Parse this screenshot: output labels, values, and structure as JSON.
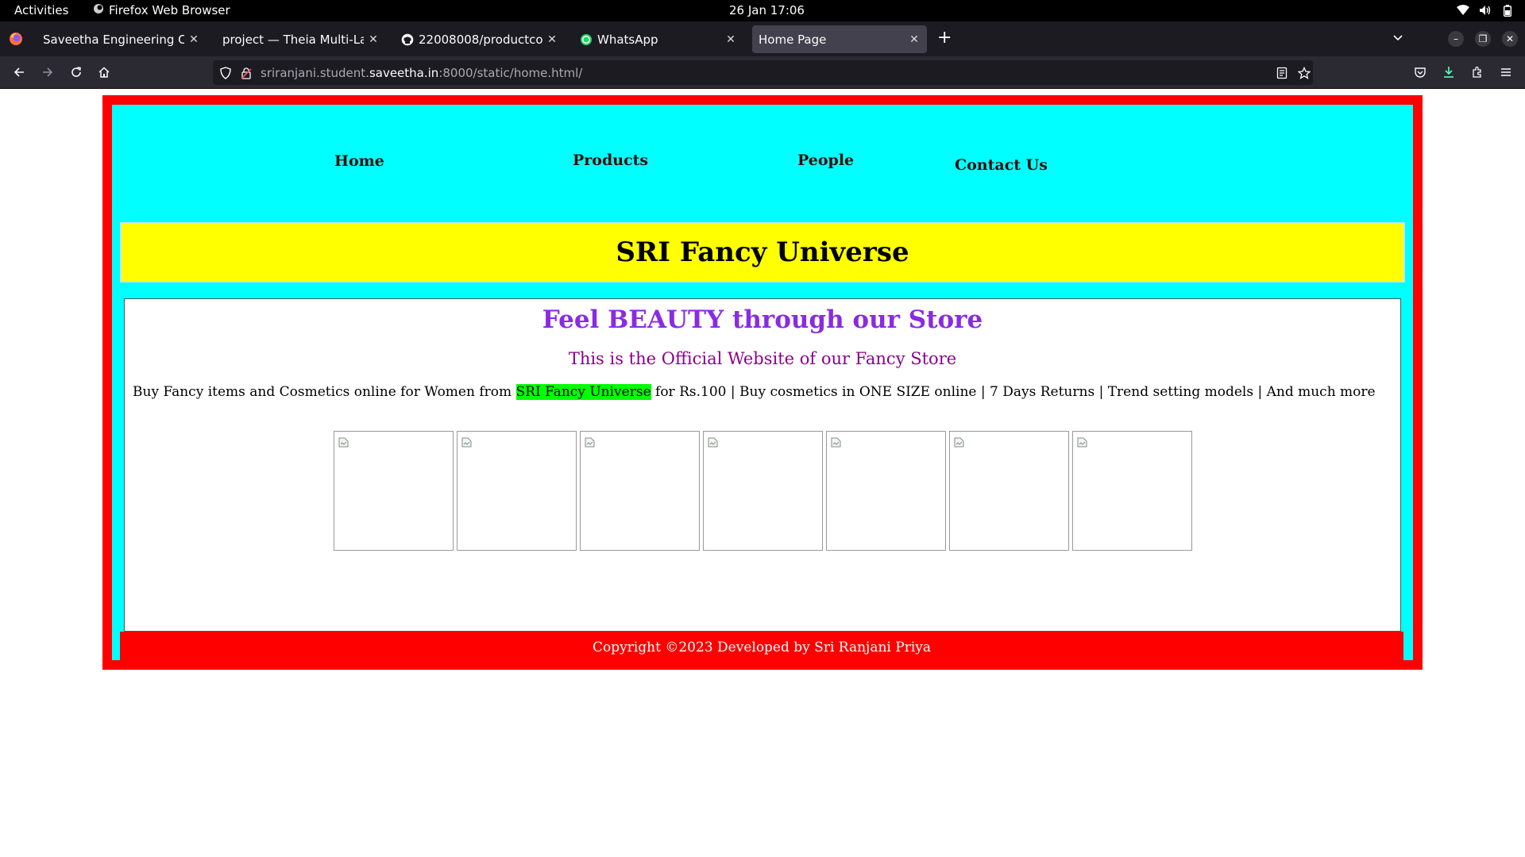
{
  "os": {
    "activities_label": "Activities",
    "app_name": "Firefox Web Browser",
    "clock": "26 Jan  17:06"
  },
  "browser": {
    "tabs": [
      {
        "title": "Saveetha Engineering College",
        "favicon": "blank-icon",
        "active": false
      },
      {
        "title": "project — Theia Multi-Language",
        "favicon": "blank-icon",
        "active": false
      },
      {
        "title": "22008008/productcompany",
        "favicon": "github-icon",
        "active": false
      },
      {
        "title": "WhatsApp",
        "favicon": "whatsapp-icon",
        "active": false
      },
      {
        "title": "Home Page",
        "favicon": "none",
        "active": true
      }
    ],
    "url": {
      "subdomain": "sriranjani.student.",
      "domain": "saveetha.in",
      "path": ":8000/static/home.html/"
    },
    "colors": {
      "tab_strip": "#1c1b22",
      "toolbar": "#2b2a33",
      "active_tab": "#42414d"
    }
  },
  "page": {
    "nav": {
      "home": "Home",
      "products": "Products",
      "people": "People",
      "contact": "Contact Us"
    },
    "site_title": "SRI Fancy Universe",
    "tagline": "Feel BEAUTY through our Store",
    "subtitle": "This is the Official Website of our Fancy Store",
    "description": {
      "before": "Buy Fancy items and Cosmetics online for Women from ",
      "highlight": "SRI Fancy Universe",
      "after": " for Rs.100 | Buy cosmetics in ONE SIZE online | 7 Days Returns | Trend setting models | And much more"
    },
    "product_images": [
      {
        "icon": "broken-image-icon"
      },
      {
        "icon": "broken-image-icon"
      },
      {
        "icon": "broken-image-icon"
      },
      {
        "icon": "broken-image-icon"
      },
      {
        "icon": "broken-image-icon"
      },
      {
        "icon": "broken-image-icon"
      },
      {
        "icon": "broken-image-icon"
      }
    ],
    "footer": "Copyright ©2023 Developed by Sri Ranjani Priya",
    "colors": {
      "frame_border": "#ff0000",
      "frame_bg": "#00ffff",
      "title_banner": "#ffff00",
      "tagline": "#8a2be2",
      "subtitle": "#8b008b",
      "highlight": "#00ff00",
      "footer_bg": "#ff0000"
    }
  }
}
